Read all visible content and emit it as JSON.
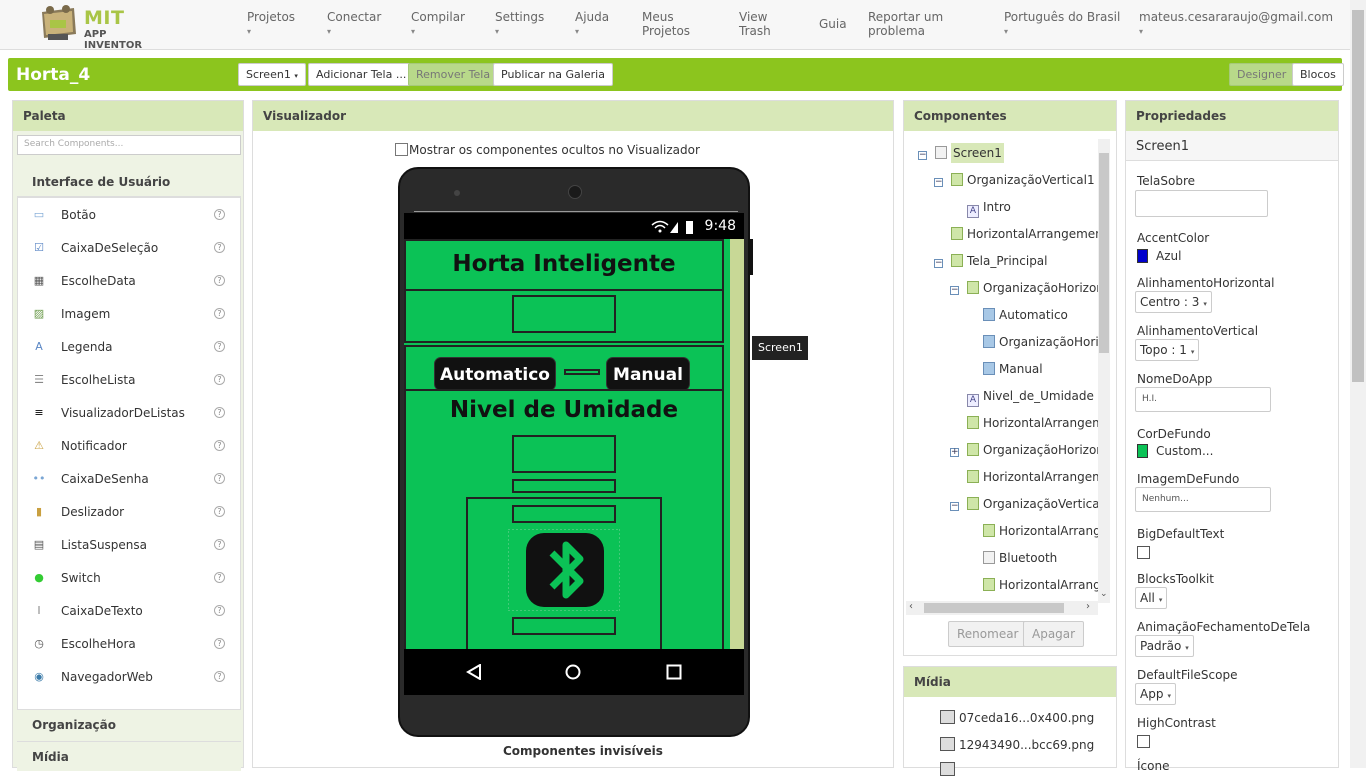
{
  "app": {
    "brand_mit": "MIT",
    "brand_sub": "APP INVENTOR"
  },
  "menu": [
    {
      "label": "Projetos",
      "dropdown": true
    },
    {
      "label": "Conectar",
      "dropdown": true
    },
    {
      "label": "Compilar",
      "dropdown": true
    },
    {
      "label": "Settings",
      "dropdown": true
    },
    {
      "label": "Ajuda",
      "dropdown": true
    },
    {
      "label": "Meus Projetos",
      "dropdown": false
    },
    {
      "label": "View Trash",
      "dropdown": false
    },
    {
      "label": "Guia",
      "dropdown": false
    },
    {
      "label": "Reportar um problema",
      "dropdown": false
    },
    {
      "label": "Português do Brasil",
      "dropdown": true
    },
    {
      "label": "mateus.cesararaujo@gmail.com",
      "dropdown": true
    }
  ],
  "toolbar": {
    "project_name": "Horta_4",
    "screen_select": "Screen1",
    "add_screen": "Adicionar Tela ...",
    "remove_screen": "Remover Tela",
    "publish": "Publicar na Galeria",
    "designer": "Designer",
    "blocks": "Blocos"
  },
  "palette": {
    "title": "Paleta",
    "search_placeholder": "Search Components...",
    "category": "Interface de Usuário",
    "items": [
      "Botão",
      "CaixaDeSeleção",
      "EscolheData",
      "Imagem",
      "Legenda",
      "EscolheLista",
      "VisualizadorDeListas",
      "Notificador",
      "CaixaDeSenha",
      "Deslizador",
      "ListaSuspensa",
      "Switch",
      "CaixaDeTexto",
      "EscolheHora",
      "NavegadorWeb"
    ],
    "help_symbol": "?",
    "other_categories": [
      "Organização",
      "Mídia"
    ]
  },
  "viewer": {
    "title": "Visualizador",
    "show_hidden": "Mostrar os componentes ocultos no Visualizador",
    "status_time": "9:48",
    "app_title": "Horta Inteligente",
    "btn_auto": "Automatico",
    "btn_manual": "Manual",
    "humidity": "Nivel de Umidade",
    "invisible": "Componentes invisíveis",
    "tooltip": "Screen1"
  },
  "components": {
    "title": "Componentes",
    "tree": [
      {
        "label": "Screen1",
        "toggle": "⊟",
        "type": "screen"
      },
      {
        "label": "OrganizaçãoVertical1",
        "toggle": "⊟",
        "type": "arr"
      },
      {
        "label": "Intro",
        "toggle": "",
        "type": "lab"
      },
      {
        "label": "HorizontalArrangemen",
        "toggle": "",
        "type": "arr"
      },
      {
        "label": "Tela_Principal",
        "toggle": "⊟",
        "type": "arr"
      },
      {
        "label": "OrganizaçãoHorizor",
        "toggle": "⊟",
        "type": "arr"
      },
      {
        "label": "Automatico",
        "toggle": "",
        "type": "img"
      },
      {
        "label": "OrganizaçãoHori",
        "toggle": "",
        "type": "img"
      },
      {
        "label": "Manual",
        "toggle": "",
        "type": "img"
      },
      {
        "label": "Nivel_de_Umidade",
        "toggle": "",
        "type": "lab"
      },
      {
        "label": "HorizontalArrangem",
        "toggle": "",
        "type": "arr"
      },
      {
        "label": "OrganizaçãoHorizor",
        "toggle": "⊞",
        "type": "arr"
      },
      {
        "label": "HorizontalArrangem",
        "toggle": "",
        "type": "arr"
      },
      {
        "label": "OrganizaçãoVertica",
        "toggle": "⊟",
        "type": "arr"
      },
      {
        "label": "HorizontalArrang",
        "toggle": "",
        "type": "arr"
      },
      {
        "label": "Bluetooth",
        "toggle": "",
        "type": "list"
      },
      {
        "label": "HorizontalArrang",
        "toggle": "",
        "type": "arr"
      }
    ],
    "rename": "Renomear",
    "delete": "Apagar"
  },
  "media": {
    "title": "Mídia",
    "files": [
      "07ceda16...0x400.png",
      "12943490...bcc69.png"
    ]
  },
  "properties": {
    "title": "Propriedades",
    "component": "Screen1",
    "tela_sobre": "TelaSobre",
    "accent_label": "AccentColor",
    "accent_value": "Azul",
    "accent_color": "#0000cc",
    "align_h_label": "AlinhamentoHorizontal",
    "align_h_value": "Centro : 3",
    "align_v_label": "AlinhamentoVertical",
    "align_v_value": "Topo : 1",
    "app_name_label": "NomeDoApp",
    "app_name_value": "H.I.",
    "bg_color_label": "CorDeFundo",
    "bg_color_value": "Custom...",
    "bg_color": "#0bc256",
    "bg_image_label": "ImagemDeFundo",
    "bg_image_value": "Nenhum...",
    "big_text_label": "BigDefaultText",
    "blocks_toolkit_label": "BlocksToolkit",
    "blocks_toolkit_value": "All",
    "anim_close_label": "AnimaçãoFechamentoDeTela",
    "anim_close_value": "Padrão",
    "file_scope_label": "DefaultFileScope",
    "file_scope_value": "App",
    "high_contrast_label": "HighContrast",
    "icon_label": "Ícone"
  },
  "colors": {
    "accent_green": "#8cc51e",
    "screen_green": "#0bc256"
  }
}
